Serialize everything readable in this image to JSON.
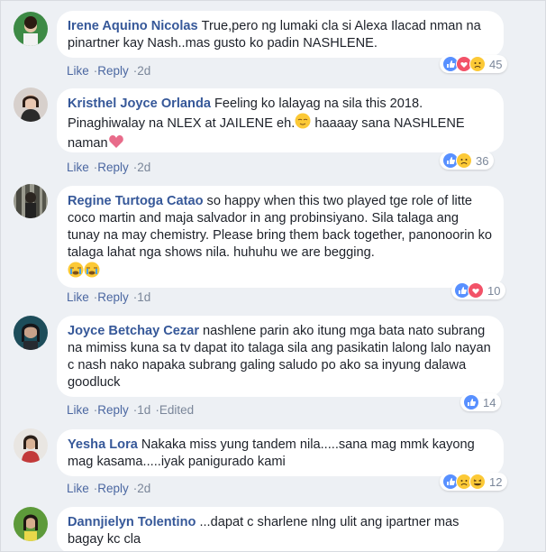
{
  "colors": {
    "author": "#365899",
    "like_blue": "#5890ff",
    "love_red": "#f25268",
    "haha_yellow": "#fcc936"
  },
  "comments": [
    {
      "author": "Irene Aquino Nicolas",
      "text": "True,pero ng lumaki cla si Alexa Ilacad nman na pinartner kay Nash..mas gusto ko padin NASHLENE.",
      "like": "Like",
      "reply": "Reply",
      "time": "2d",
      "count": "45",
      "reactions": [
        "like-icon",
        "love-icon",
        "sad-icon"
      ]
    },
    {
      "author": "Kristhel Joyce Orlanda",
      "text1": "Feeling ko lalayag na sila this 2018. Pinaghiwalay na NLEX at JAILENE eh.",
      "text2": " haaaay sana NASHLENE naman",
      "like": "Like",
      "reply": "Reply",
      "time": "2d",
      "count": "36",
      "reactions": [
        "like-icon",
        "sad-icon"
      ]
    },
    {
      "author": "Regine Turtoga Catao",
      "text": "so happy when this two played tge role of litte coco martin and maja salvador in ang probinsiyano. Sila talaga ang tunay na may chemistry. Please bring them back together, panonoorin ko talaga lahat nga shows nila. huhuhu we are begging.",
      "like": "Like",
      "reply": "Reply",
      "time": "1d",
      "count": "10",
      "reactions": [
        "like-icon",
        "love-icon"
      ]
    },
    {
      "author": "Joyce Betchay Cezar",
      "text": "nashlene parin ako itung mga bata nato subrang na mimiss kuna sa tv dapat ito talaga sila ang pasikatin lalong lalo nayan c nash nako napaka subrang galing saludo po ako sa inyung dalawa goodluck",
      "like": "Like",
      "reply": "Reply",
      "time": "1d",
      "edited": "Edited",
      "count": "14",
      "reactions": [
        "like-icon"
      ]
    },
    {
      "author": "Yesha Lora",
      "text": "Nakaka miss yung tandem nila.....sana mag mmk kayong mag kasama.....iyak panigurado kami",
      "like": "Like",
      "reply": "Reply",
      "time": "2d",
      "count": "12",
      "reactions": [
        "like-icon",
        "sad-icon",
        "haha-icon"
      ]
    },
    {
      "author": "Dannjielyn Tolentino",
      "text": "...dapat c sharlene nlng ulit ang ipartner mas bagay kc cla"
    }
  ]
}
